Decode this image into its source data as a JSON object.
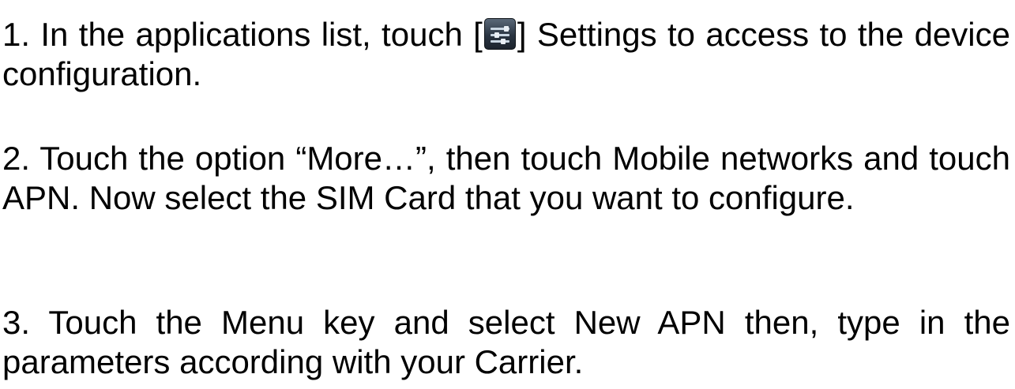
{
  "steps": [
    {
      "before_icon": "1. In the applications list, touch [",
      "icon": "settings-icon",
      "after_icon": "] Settings to access to the device configuration."
    },
    {
      "text": "2. Touch the option “More…”, then touch Mobile networks and touch APN. Now select the SIM Card that you want to configure."
    },
    {
      "text": "3. Touch the Menu key and select New APN then, type in the parameters according with your Carrier."
    }
  ]
}
